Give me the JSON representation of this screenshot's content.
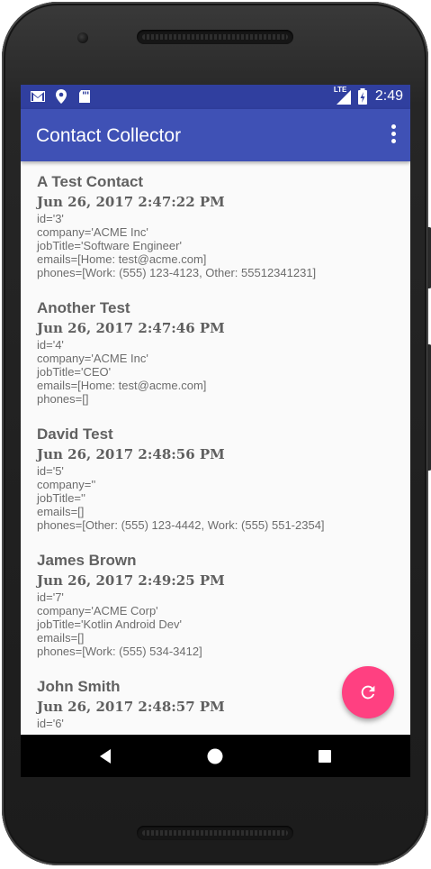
{
  "app": {
    "title": "Contact Collector",
    "overflow_icon": "more-vert-icon"
  },
  "status_bar": {
    "time": "2:49",
    "network": "LTE",
    "icons": [
      "gmail-icon",
      "location-icon",
      "sd-card-icon",
      "signal-icon",
      "battery-charging-icon"
    ],
    "color": "#303f9f"
  },
  "colors": {
    "primary": "#3f51b5",
    "accent": "#ff4081"
  },
  "contacts": [
    {
      "name": "A Test Contact",
      "date": "Jun 26, 2017 2:47:22 PM",
      "id": "id='3'",
      "company": "company='ACME Inc'",
      "jobTitle": "jobTitle='Software Engineer'",
      "emails": "emails=[Home: test@acme.com]",
      "phones": "phones=[Work: (555) 123-4123, Other: 55512341231]"
    },
    {
      "name": "Another Test",
      "date": "Jun 26, 2017 2:47:46 PM",
      "id": "id='4'",
      "company": "company='ACME Inc'",
      "jobTitle": "jobTitle='CEO'",
      "emails": "emails=[Home: test@acme.com]",
      "phones": "phones=[]"
    },
    {
      "name": "David Test",
      "date": "Jun 26, 2017 2:48:56 PM",
      "id": "id='5'",
      "company": "company=''",
      "jobTitle": "jobTitle=''",
      "emails": "emails=[]",
      "phones": "phones=[Other: (555) 123-4442, Work: (555) 551-2354]"
    },
    {
      "name": "James Brown",
      "date": "Jun 26, 2017 2:49:25 PM",
      "id": "id='7'",
      "company": "company='ACME Corp'",
      "jobTitle": "jobTitle='Kotlin Android Dev'",
      "emails": "emails=[]",
      "phones": "phones=[Work: (555) 534-3412]"
    },
    {
      "name": "John Smith",
      "date": "Jun 26, 2017 2:48:57 PM",
      "id": "id='6'",
      "company": "",
      "jobTitle": "",
      "emails": "",
      "phones": ""
    }
  ],
  "fab": {
    "icon": "refresh-icon"
  },
  "nav_bar": {
    "icons": [
      "back-icon",
      "home-icon",
      "recents-icon"
    ]
  }
}
